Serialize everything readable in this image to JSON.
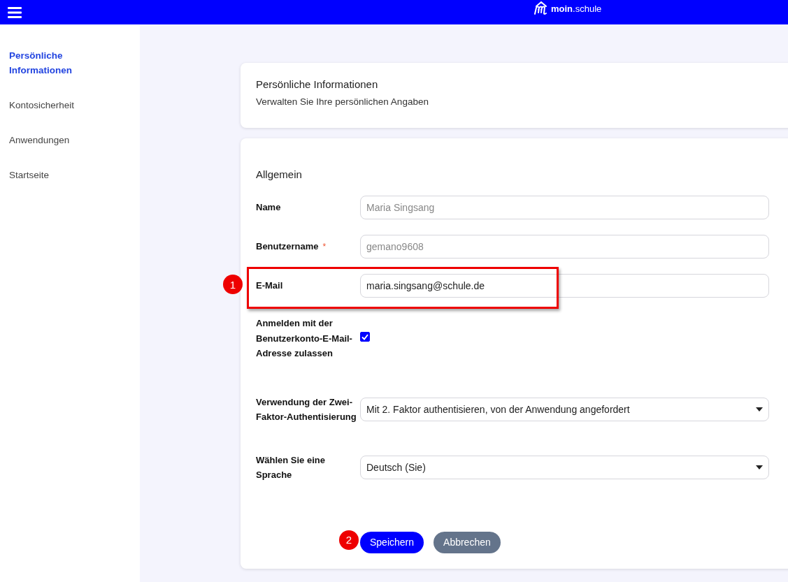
{
  "header": {
    "logo_text": "**moin**.schule"
  },
  "sidebar": {
    "items": [
      {
        "label": "Persönliche Informationen",
        "selected": true
      },
      {
        "label": "Kontosicherheit",
        "selected": false
      },
      {
        "label": "Anwendungen",
        "selected": false
      },
      {
        "label": "Startseite",
        "selected": false
      }
    ]
  },
  "intro_card": {
    "title": "Persönliche Informationen",
    "subtitle": "Verwalten Sie Ihre persönlichen Angaben"
  },
  "form": {
    "heading": "Allgemein",
    "fields": [
      {
        "kind": "text",
        "label": "Name",
        "value": "Maria Singsang",
        "disabled": true,
        "highlighted": false
      },
      {
        "kind": "text",
        "label": "Benutzername",
        "required_mark": "*",
        "value": "gemano9608",
        "disabled": true,
        "highlighted": false
      },
      {
        "kind": "text",
        "label": "E-Mail",
        "value": "maria.singsang@schule.de",
        "disabled": false,
        "highlighted": true,
        "annotation": "1"
      },
      {
        "kind": "checkbox",
        "label": "Anmelden mit der Benutzerkonto-E-Mail-Adresse zulassen",
        "checked": true
      },
      {
        "kind": "select",
        "label": "Verwendung der Zwei-Faktor-Authentisierung",
        "value": "Mit 2. Faktor authentisieren, von der Anwendung angefordert"
      },
      {
        "kind": "select",
        "label": "Wählen Sie eine Sprache",
        "value": "Deutsch (Sie)"
      }
    ],
    "buttons": [
      {
        "kind": "primary",
        "label": "Speichern",
        "annotation": "2"
      },
      {
        "kind": "secondary",
        "label": "Abbrechen"
      }
    ]
  }
}
